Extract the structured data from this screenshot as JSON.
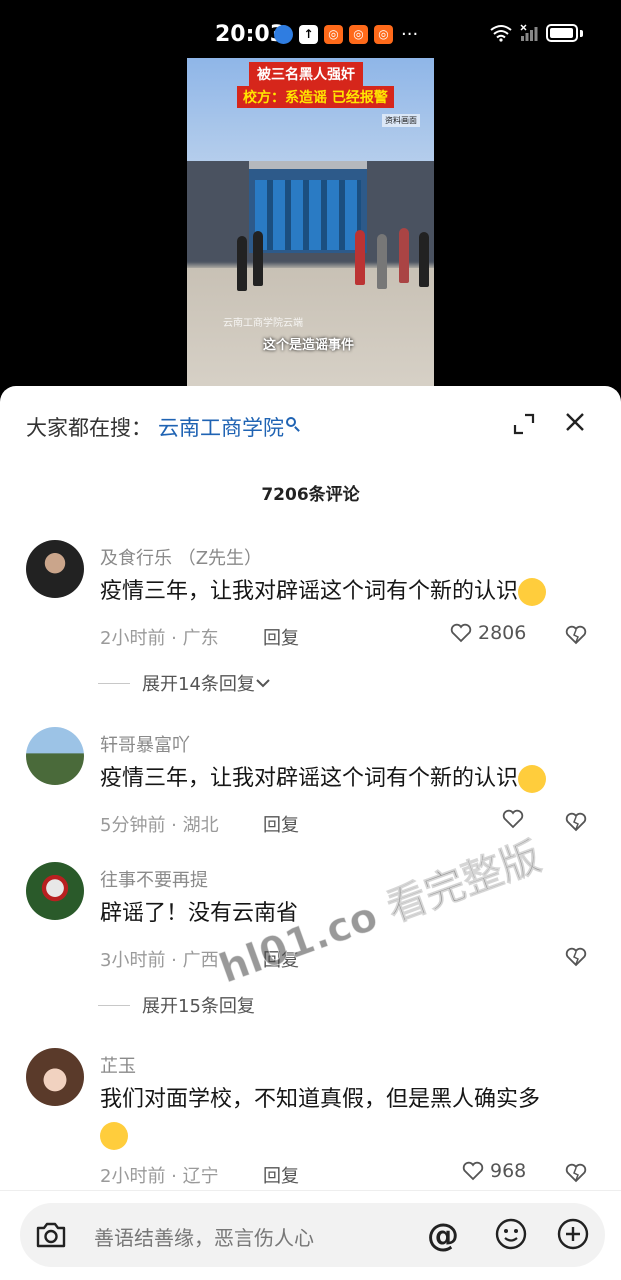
{
  "status_bar": {
    "time": "20:03",
    "more": "···"
  },
  "video": {
    "banner_line1": "被三名黑人强奸",
    "banner_line2": "校方：系造谣 已经报警",
    "source_tag": "资料画面",
    "watermark_tag": "云南工商学院云端",
    "subtitle": "这个是造谣事件"
  },
  "sheet": {
    "search_prefix": "大家都在搜：",
    "search_term": "云南工商学院",
    "comment_count": "7206条评论"
  },
  "comments": [
    {
      "username": "及食行乐 （Z先生）",
      "text": "疫情三年，让我对辟谣这个词有个新的认识",
      "time_location": "2小时前 · 广东",
      "reply": "回复",
      "likes": "2806",
      "expand": "展开14条回复",
      "emoji": "flushed-face"
    },
    {
      "username": "轩哥暴富吖",
      "text": "疫情三年，让我对辟谣这个词有个新的认识",
      "time_location": "5分钟前 · 湖北",
      "reply": "回复",
      "likes": "",
      "emoji": "flushed-face"
    },
    {
      "username": "往事不要再提",
      "text": "辟谣了！没有云南省",
      "time_location": "3小时前 · 广西",
      "reply": "回复",
      "likes": "",
      "expand": "展开15条回复"
    },
    {
      "username": "芷玉",
      "text": "我们对面学校，不知道真假，但是黑人确实多",
      "time_location": "2小时前 · 辽宁",
      "reply": "回复",
      "likes": "968",
      "emoji": "crying-face"
    }
  ],
  "input": {
    "placeholder": "善语结善缘，恶言伤人心",
    "at_symbol": "@"
  },
  "overlay_watermark": "hl01.co 看完整版",
  "colors": {
    "link_blue": "#1f63b3",
    "status_orange": "#ff6a1a",
    "banner_red": "#d6261b"
  }
}
